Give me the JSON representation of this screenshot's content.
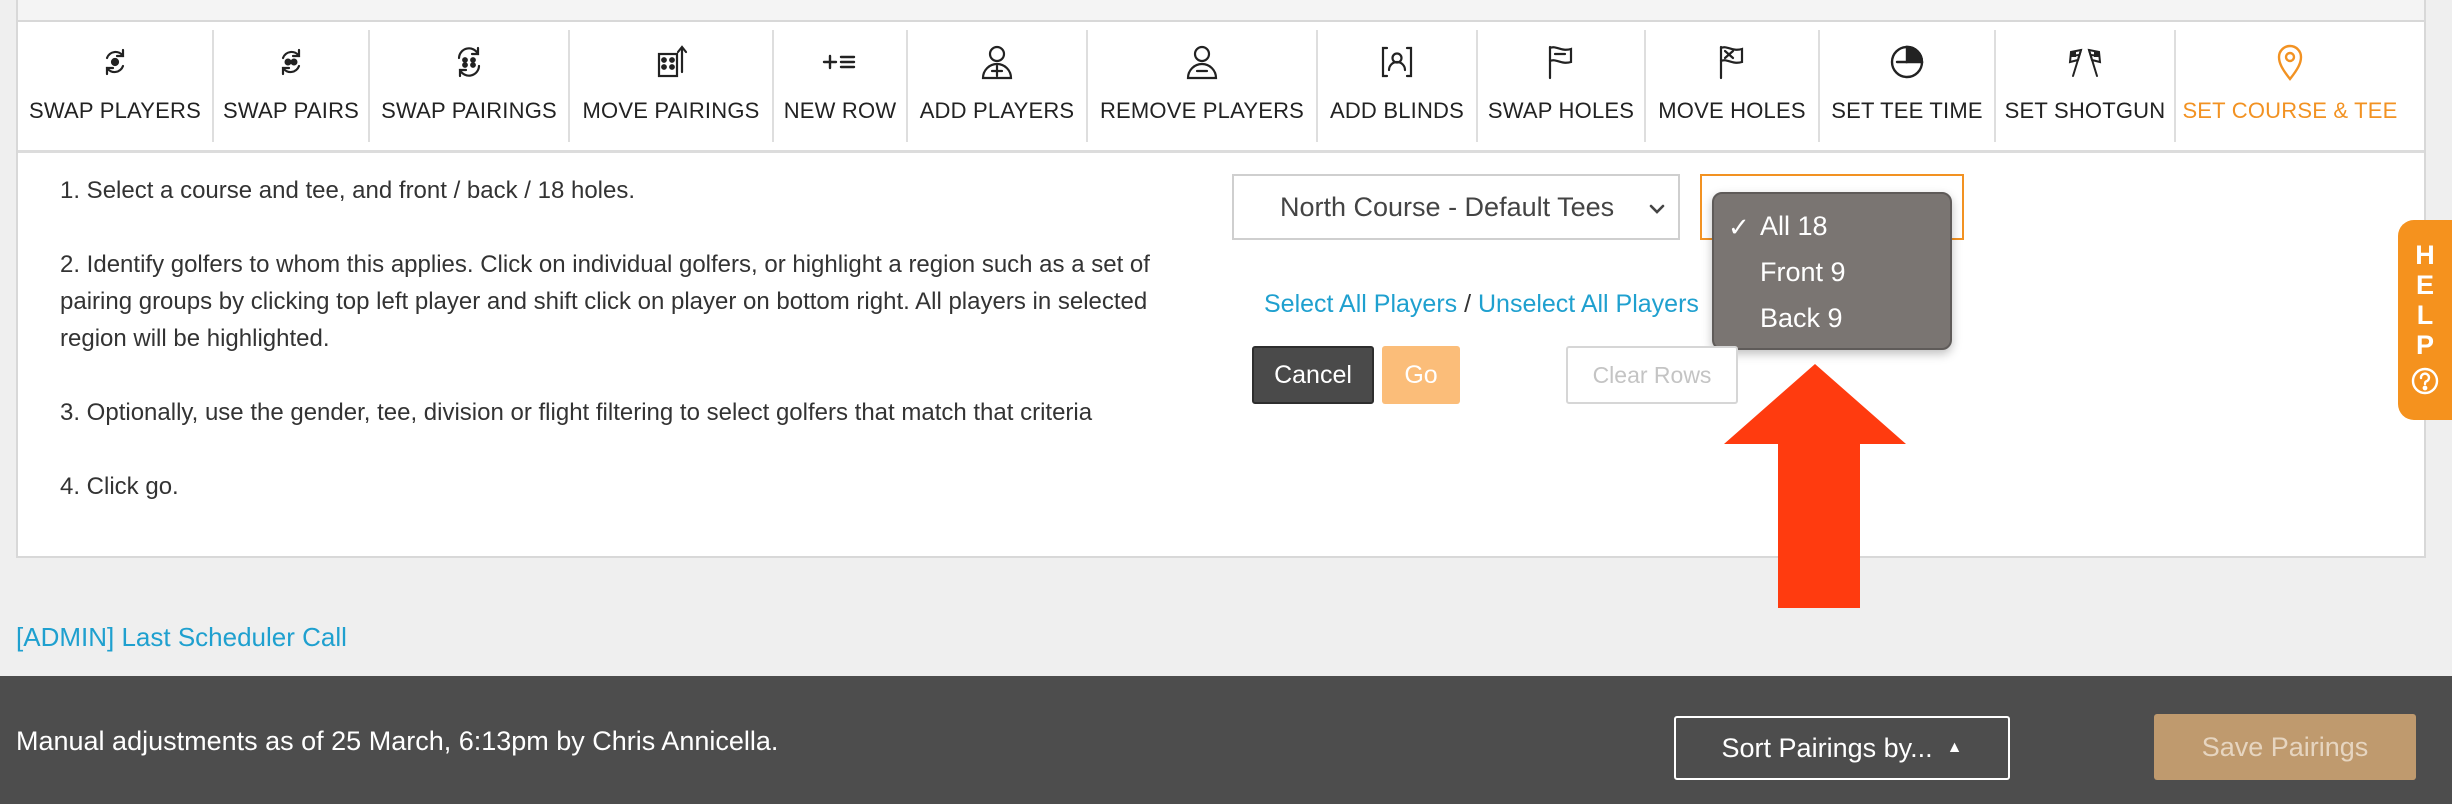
{
  "toolbar": {
    "items": [
      {
        "label": "SWAP PLAYERS",
        "icon": "swap-players-icon"
      },
      {
        "label": "SWAP PAIRS",
        "icon": "swap-pairs-icon"
      },
      {
        "label": "SWAP PAIRINGS",
        "icon": "swap-pairings-icon"
      },
      {
        "label": "MOVE PAIRINGS",
        "icon": "move-pairings-icon"
      },
      {
        "label": "NEW ROW",
        "icon": "new-row-icon"
      },
      {
        "label": "ADD PLAYERS",
        "icon": "add-player-icon"
      },
      {
        "label": "REMOVE PLAYERS",
        "icon": "remove-player-icon"
      },
      {
        "label": "ADD BLINDS",
        "icon": "add-blinds-icon"
      },
      {
        "label": "SWAP HOLES",
        "icon": "swap-holes-flag-icon"
      },
      {
        "label": "MOVE HOLES",
        "icon": "move-holes-flag-icon"
      },
      {
        "label": "SET TEE TIME",
        "icon": "clock-icon"
      },
      {
        "label": "SET SHOTGUN",
        "icon": "checkered-flags-icon"
      },
      {
        "label": "SET COURSE & TEE",
        "icon": "map-pin-icon",
        "active": true
      }
    ],
    "active_color": "#f29222"
  },
  "instructions": {
    "step1": "1. Select a course and tee, and front / back / 18 holes.",
    "step2": "2. Identify golfers to whom this applies. Click on individual golfers, or highlight a region such as a set of pairing groups by clicking top left player and shift click on player on bottom right. All players in selected region will be highlighted.",
    "step3": "3. Optionally, use the gender, tee, division or flight filtering to select golfers that match that criteria",
    "step4": "4. Click go."
  },
  "course_select": {
    "selected": "North Course - Default Tees"
  },
  "holes_select": {
    "options": [
      "All 18",
      "Front 9",
      "Back 9"
    ],
    "selected_index": 0,
    "check_mark": "✓"
  },
  "selection_links": {
    "select_all": "Select All Players",
    "separator": " / ",
    "unselect_all": "Unselect All Players"
  },
  "buttons": {
    "cancel": "Cancel",
    "go": "Go",
    "clear_rows": "Clear Rows"
  },
  "help": {
    "letters": [
      "H",
      "E",
      "L",
      "P"
    ],
    "color": "#f5921e"
  },
  "admin_link": "[ADMIN] Last Scheduler Call",
  "footer": {
    "message": "Manual adjustments as of 25 March, 6:13pm by Chris Annicella.",
    "sort_label": "Sort Pairings by...",
    "sort_caret": "▲",
    "save_label": "Save Pairings"
  },
  "annotation": {
    "arrow_color": "#ff3b0f"
  }
}
